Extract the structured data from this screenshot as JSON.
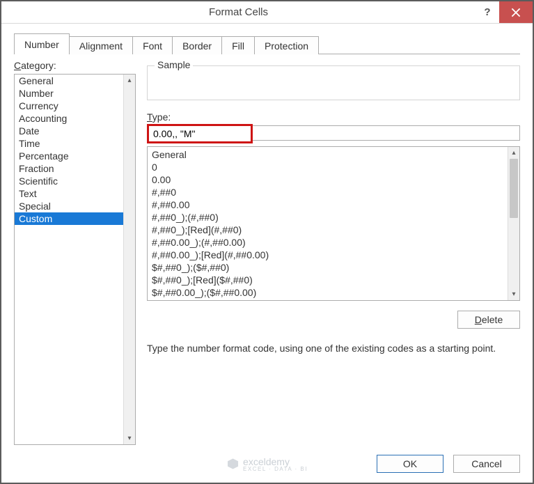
{
  "window": {
    "title": "Format Cells",
    "help_symbol": "?",
    "close_symbol": "×"
  },
  "tabs": [
    {
      "label": "Number",
      "active": true
    },
    {
      "label": "Alignment",
      "active": false
    },
    {
      "label": "Font",
      "active": false
    },
    {
      "label": "Border",
      "active": false
    },
    {
      "label": "Fill",
      "active": false
    },
    {
      "label": "Protection",
      "active": false
    }
  ],
  "category": {
    "label_prefix": "C",
    "label_rest": "ategory:",
    "items": [
      {
        "label": "General",
        "selected": false
      },
      {
        "label": "Number",
        "selected": false
      },
      {
        "label": "Currency",
        "selected": false
      },
      {
        "label": "Accounting",
        "selected": false
      },
      {
        "label": "Date",
        "selected": false
      },
      {
        "label": "Time",
        "selected": false
      },
      {
        "label": "Percentage",
        "selected": false
      },
      {
        "label": "Fraction",
        "selected": false
      },
      {
        "label": "Scientific",
        "selected": false
      },
      {
        "label": "Text",
        "selected": false
      },
      {
        "label": "Special",
        "selected": false
      },
      {
        "label": "Custom",
        "selected": true
      }
    ]
  },
  "sample": {
    "legend": "Sample",
    "value": ""
  },
  "type": {
    "label_prefix": "T",
    "label_rest": "ype:",
    "value": "0.00,, \"M\""
  },
  "format_codes": [
    "General",
    "0",
    "0.00",
    "#,##0",
    "#,##0.00",
    "#,##0_);(#,##0)",
    "#,##0_);[Red](#,##0)",
    "#,##0.00_);(#,##0.00)",
    "#,##0.00_);[Red](#,##0.00)",
    "$#,##0_);($#,##0)",
    "$#,##0_);[Red]($#,##0)",
    "$#,##0.00_);($#,##0.00)"
  ],
  "buttons": {
    "delete_prefix": "D",
    "delete_rest": "elete",
    "ok": "OK",
    "cancel": "Cancel"
  },
  "hint": "Type the number format code, using one of the existing codes as a starting point.",
  "watermark": {
    "brand": "exceldemy",
    "sub": "EXCEL · DATA · BI"
  }
}
